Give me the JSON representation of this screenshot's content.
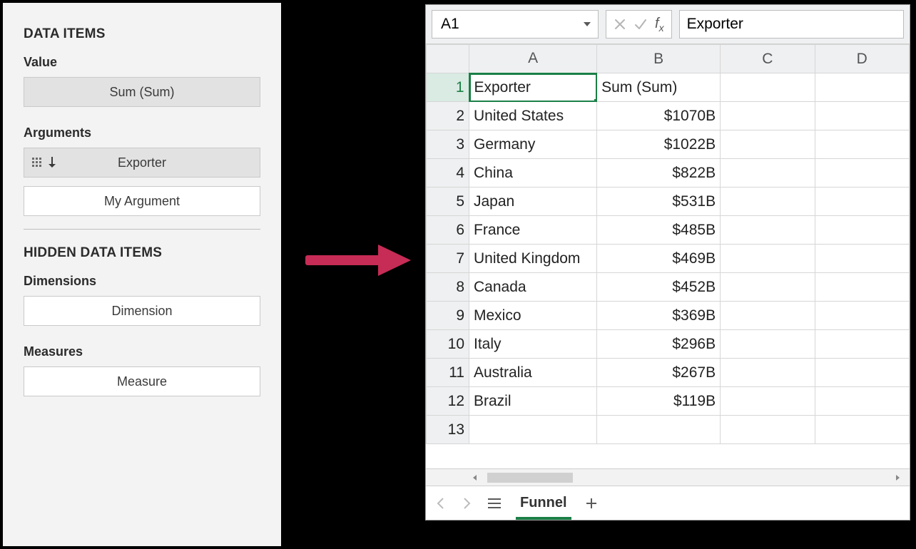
{
  "left": {
    "title1": "DATA ITEMS",
    "value_label": "Value",
    "value_field": "Sum (Sum)",
    "arguments_label": "Arguments",
    "argument1": "Exporter",
    "argument2": "My Argument",
    "title2": "HIDDEN DATA ITEMS",
    "dimensions_label": "Dimensions",
    "dimension_field": "Dimension",
    "measures_label": "Measures",
    "measure_field": "Measure"
  },
  "spreadsheet": {
    "name_box": "A1",
    "formula_value": "Exporter",
    "columns": [
      "A",
      "B",
      "C",
      "D"
    ],
    "active_cell": "A1",
    "header_row": {
      "A": "Exporter",
      "B": "Sum (Sum)"
    },
    "rows": [
      {
        "n": 2,
        "A": "United States",
        "B": "$1070B"
      },
      {
        "n": 3,
        "A": "Germany",
        "B": "$1022B"
      },
      {
        "n": 4,
        "A": "China",
        "B": "$822B"
      },
      {
        "n": 5,
        "A": "Japan",
        "B": "$531B"
      },
      {
        "n": 6,
        "A": "France",
        "B": "$485B"
      },
      {
        "n": 7,
        "A": "United Kingdom",
        "B": "$469B"
      },
      {
        "n": 8,
        "A": "Canada",
        "B": "$452B"
      },
      {
        "n": 9,
        "A": "Mexico",
        "B": "$369B"
      },
      {
        "n": 10,
        "A": "Italy",
        "B": "$296B"
      },
      {
        "n": 11,
        "A": "Australia",
        "B": "$267B"
      },
      {
        "n": 12,
        "A": "Brazil",
        "B": "$119B"
      }
    ],
    "empty_row": 13,
    "tab_name": "Funnel"
  },
  "chart_data": {
    "type": "table",
    "title": "Exporter — Sum (Sum)",
    "columns": [
      "Exporter",
      "Sum (Sum)"
    ],
    "rows": [
      [
        "United States",
        "$1070B"
      ],
      [
        "Germany",
        "$1022B"
      ],
      [
        "China",
        "$822B"
      ],
      [
        "Japan",
        "$531B"
      ],
      [
        "France",
        "$485B"
      ],
      [
        "United Kingdom",
        "$469B"
      ],
      [
        "Canada",
        "$452B"
      ],
      [
        "Mexico",
        "$369B"
      ],
      [
        "Italy",
        "$296B"
      ],
      [
        "Australia",
        "$267B"
      ],
      [
        "Brazil",
        "$119B"
      ]
    ]
  }
}
